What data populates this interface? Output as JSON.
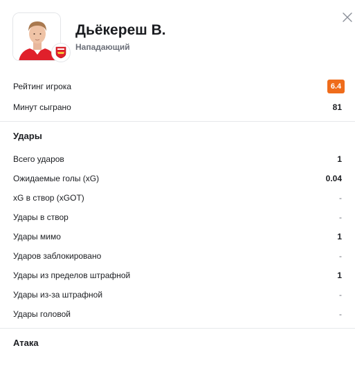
{
  "player": {
    "name": "Дьёкереш В.",
    "position": "Нападающий"
  },
  "summary": {
    "rating_label": "Рейтинг игрока",
    "rating_value": "6.4",
    "rating_color": "#ef6c1b",
    "minutes_label": "Минут сыграно",
    "minutes_value": "81"
  },
  "shots": {
    "title": "Удары",
    "rows": [
      {
        "label": "Всего ударов",
        "value": "1"
      },
      {
        "label": "Ожидаемые голы (xG)",
        "value": "0.04"
      },
      {
        "label": "xG в створ (xGOT)",
        "value": "-"
      },
      {
        "label": "Удары в створ",
        "value": "-"
      },
      {
        "label": "Удары мимо",
        "value": "1"
      },
      {
        "label": "Ударов заблокировано",
        "value": "-"
      },
      {
        "label": "Удары из пределов штрафной",
        "value": "1"
      },
      {
        "label": "Удары из-за штрафной",
        "value": "-"
      },
      {
        "label": "Удары головой",
        "value": "-"
      }
    ]
  },
  "attack": {
    "title": "Атака"
  },
  "icons": {
    "close": "close-icon",
    "club": "club-crest-icon",
    "player": "player-photo"
  }
}
